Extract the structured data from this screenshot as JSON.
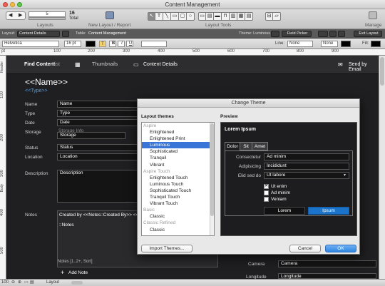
{
  "window": {
    "title": "Content Management"
  },
  "toolbar": {
    "record_value": "5",
    "record_count": "16",
    "record_total_label": "Total",
    "layouts_label": "Layouts",
    "new_layout_label": "New Layout / Report",
    "layout_tools_label": "Layout Tools",
    "manage_label": "Manage"
  },
  "layout_bar": {
    "layout_label": "Layout:",
    "layout_value": "Content Details",
    "table_label": "Table:",
    "table_value": "Content Management",
    "theme_label": "Theme: Luminous",
    "field_picker": "Field Picker",
    "exit_layout": "Exit Layout"
  },
  "format_bar": {
    "font": "Helvetica",
    "size": "16 pt",
    "bold": "B",
    "italic": "I",
    "underline": "U",
    "line_label": "Line:",
    "line_value": "None",
    "line2_value": "None",
    "fill_label": "Fill:"
  },
  "ruler": {
    "unit": "pt",
    "ticks": [
      "100",
      "200",
      "300",
      "400",
      "500",
      "600",
      "700",
      "800",
      "900"
    ],
    "vticks": [
      "100",
      "200",
      "300",
      "400",
      "500"
    ],
    "header_label": "Header",
    "body_label": "Body"
  },
  "layout_content": {
    "find_label": "Find Content",
    "list_label": "List",
    "thumbnails_label": "Thumbnails",
    "details_label": "Content Details",
    "send_email_label": "Send by Email",
    "name_heading": "<<Name>>",
    "type_heading": "<<Type>>",
    "fields": [
      {
        "label": "Name",
        "value": "Name"
      },
      {
        "label": "Type",
        "value": "Type"
      },
      {
        "label": "Date",
        "value": "Date"
      },
      {
        "label": "Storage",
        "value": "Storage"
      },
      {
        "label": "Status",
        "value": "Status"
      },
      {
        "label": "Location",
        "value": "Location"
      },
      {
        "label": "Description",
        "value": "Description"
      }
    ],
    "storage_info": "Storage Info",
    "notes_label": "Notes",
    "notes_created": "Created by <<Notes::Created By>> <<",
    "notes_field": "::Notes",
    "notes_portal": "Notes [1..2+, Sort]",
    "add_note": "Add Note",
    "camera_label": "Camera",
    "camera_value": "Camera",
    "longitude_label": "Longitude",
    "longitude_value": "Longitude"
  },
  "dialog": {
    "title": "Change Theme",
    "themes_heading": "Layout themes",
    "preview_heading": "Preview",
    "themes": [
      {
        "text": "Aspire",
        "group": true
      },
      {
        "text": "Enlightened",
        "group": false
      },
      {
        "text": "Enlightened Print",
        "group": false
      },
      {
        "text": "Luminous",
        "group": false,
        "selected": true
      },
      {
        "text": "Sophisticated",
        "group": false
      },
      {
        "text": "Tranquil",
        "group": false
      },
      {
        "text": "Vibrant",
        "group": false
      },
      {
        "text": "Aspire Touch",
        "group": true
      },
      {
        "text": "Enlightened Touch",
        "group": false
      },
      {
        "text": "Luminous Touch",
        "group": false
      },
      {
        "text": "Sophisticated Touch",
        "group": false
      },
      {
        "text": "Tranquil Touch",
        "group": false
      },
      {
        "text": "Vibrant Touch",
        "group": false
      },
      {
        "text": "Basic",
        "group": true
      },
      {
        "text": "Classic",
        "group": false
      },
      {
        "text": "Classic Refined",
        "group": true
      },
      {
        "text": "Classic",
        "group": false
      }
    ],
    "preview": {
      "title": "Lorem Ipsum",
      "tabs": [
        "Dolor",
        "Sit",
        "Amet"
      ],
      "fields": [
        {
          "label": "Consectetur",
          "value": "Ad minim"
        },
        {
          "label": "Adipisicing",
          "value": "Incididunt"
        },
        {
          "label": "Elid sed do",
          "value": "Ut labore"
        }
      ],
      "checkboxes": [
        {
          "label": "Ut enim",
          "checked": true
        },
        {
          "label": "Ad minim",
          "checked": false
        },
        {
          "label": "Veniam",
          "checked": false
        }
      ],
      "button_lorem": "Lorem",
      "button_ipsum": "Ipsum"
    },
    "import_button": "Import Themes...",
    "cancel_button": "Cancel",
    "ok_button": "OK"
  },
  "status_bar": {
    "zoom": "100",
    "mode": "Layout"
  },
  "colors": {
    "selection": "#3875d7",
    "accent_blue": "#4a9be8",
    "canvas": "#1f1f21"
  }
}
